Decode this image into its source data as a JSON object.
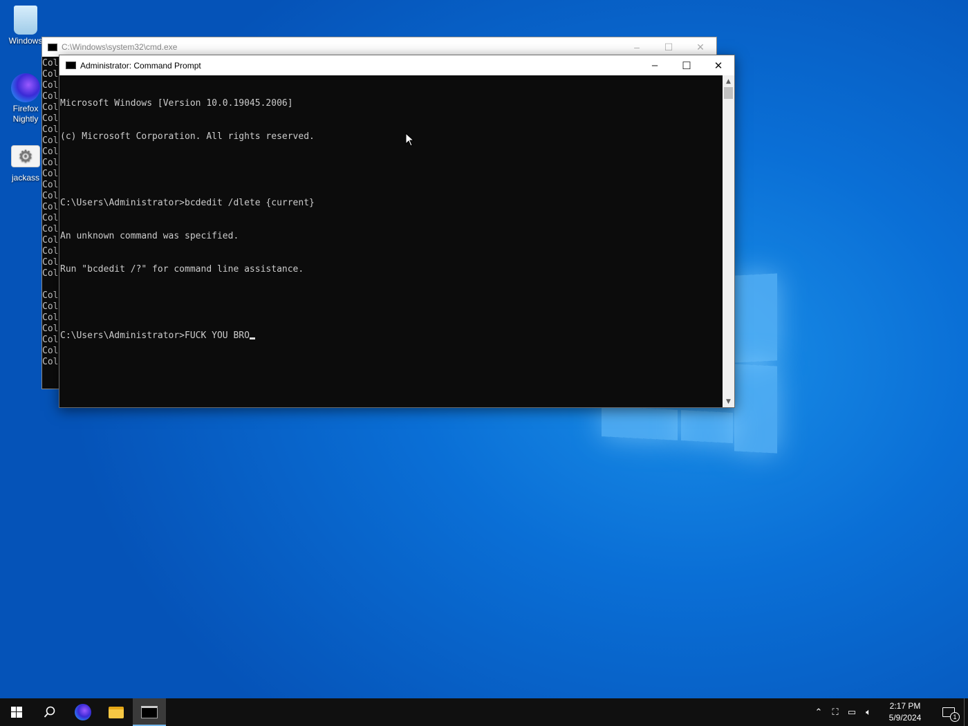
{
  "desktop": {
    "icons": [
      {
        "label": "Windows",
        "icon": "recycle-bin-icon"
      },
      {
        "label": "Firefox\nNightly",
        "icon": "firefox-nightly-icon"
      },
      {
        "label": "jackass",
        "icon": "settings-shortcut-icon"
      }
    ]
  },
  "background_window": {
    "title": "C:\\Windows\\system32\\cmd.exe",
    "lines": [
      "Col",
      "Col",
      "Col",
      "Col",
      "Col",
      "Col",
      "Col",
      "Col",
      "Col",
      "Col",
      "Col",
      "Col",
      "Col",
      "Col",
      "Col",
      "Col",
      "Col",
      "Col",
      "Col",
      "Col",
      "",
      "Col",
      "Col",
      "Col",
      "Col",
      "Col",
      "Col",
      "Col"
    ]
  },
  "foreground_window": {
    "title": "Administrator: Command Prompt",
    "lines": [
      "Microsoft Windows [Version 10.0.19045.2006]",
      "(c) Microsoft Corporation. All rights reserved.",
      "",
      "C:\\Users\\Administrator>bcdedit /dlete {current}",
      "An unknown command was specified.",
      "Run \"bcdedit /?\" for command line assistance.",
      "",
      "C:\\Users\\Administrator>FUCK YOU BRO"
    ]
  },
  "taskbar": {
    "pinned": [
      "start-icon",
      "search-icon",
      "firefox-nightly-icon",
      "file-explorer-icon",
      "command-prompt-icon"
    ],
    "active": "command-prompt-icon",
    "clock": {
      "time": "2:17 PM",
      "date": "5/9/2024"
    },
    "notification_count": "1"
  },
  "colors": {
    "accent": "#0a6fd6",
    "console_bg": "#0c0c0c",
    "console_text": "#cccccc",
    "taskbar": "#101010"
  }
}
